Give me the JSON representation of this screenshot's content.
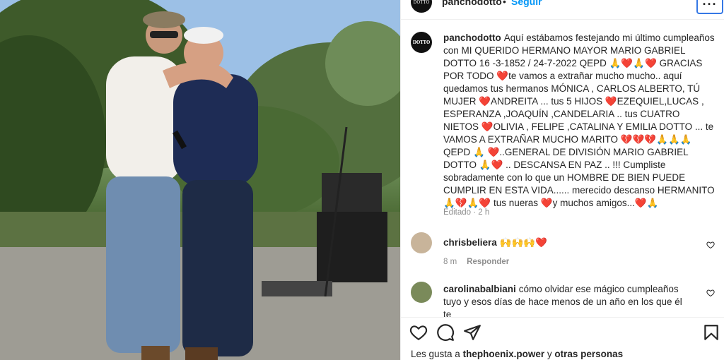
{
  "header": {
    "username": "panchodotto",
    "separator": "•",
    "follow_label": "Seguir",
    "more_label": "···",
    "avatar_text": "DOTTO"
  },
  "caption": {
    "username": "panchodotto",
    "avatar_text": "DOTTO",
    "text": "Aquí estábamos festejando mi último cumpleaños con MI QUERIDO HERMANO MAYOR MARIO GABRIEL DOTTO 16 -3-1852 / 24-7-2022 QEPD 🙏❤️🙏❤️ GRACIAS POR TODO ❤️te vamos a extrañar mucho mucho.. aquí quedamos tus hermanos MÓNICA , CARLOS ALBERTO, TÚ MUJER ❤️ANDREITA ... tus 5 HIJOS ❤️EZEQUIEL,LUCAS , ESPERANZA ,JOAQUÍN ,CANDELARIA .. tus CUATRO NIETOS ❤️OLIVIA , FELIPE ,CATALINA Y EMILIA DOTTO ... te VAMOS A EXTRAÑAR MUCHO MARITO 💔💔💔🙏🙏🙏QEPD 🙏 ❤️..GENERAL DE DIVISIÓN MARIO GABRIEL DOTTO 🙏❤️ .. DESCANSA EN PAZ .. !!! Cumpliste sobradamente con lo que un HOMBRE DE BIEN PUEDE CUMPLIR EN ESTA VIDA...... merecido descanso HERMANITO 🙏💔🙏❤️ tus nueras ❤️y muchos amigos...❤️🙏",
    "edited": "Editado · 2 h"
  },
  "comments": [
    {
      "username": "chrisbeliera",
      "text": "🙌🙌🙌❤️",
      "time": "8 m",
      "reply_label": "Responder",
      "avatar_color": "#c8b49a"
    },
    {
      "username": "carolinabalbiani",
      "text": "cómo olvidar ese mágico cumpleaños tuyo y esos días de hace menos de un año en los que él te",
      "avatar_color": "#7a8a5a"
    }
  ],
  "actions": {
    "like_icon": "heart-outline-icon",
    "comment_icon": "comment-icon",
    "share_icon": "send-icon",
    "save_icon": "bookmark-icon"
  },
  "likes": {
    "prefix": "Les gusta a",
    "user": "thephoenix.power",
    "connector": "y",
    "others": "otras personas"
  }
}
